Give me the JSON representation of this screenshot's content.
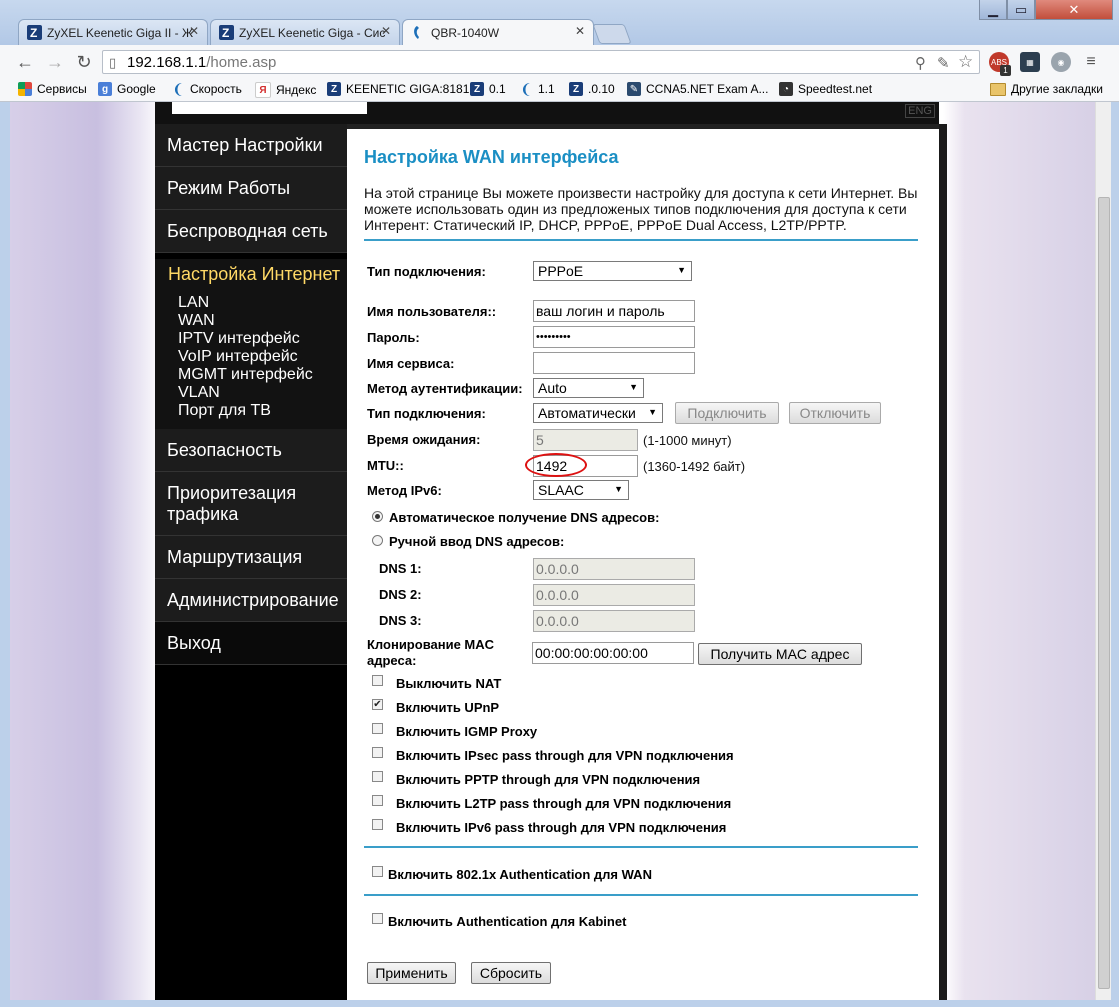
{
  "browser": {
    "tabs": [
      {
        "title": "ZyXEL Keenetic Giga II - Ж"
      },
      {
        "title": "ZyXEL Keenetic Giga - Сис"
      },
      {
        "title": "QBR-1040W"
      }
    ],
    "url_host": "192.168.1.1",
    "url_path": "/home.asp",
    "bookmarks": [
      {
        "label": "Сервисы",
        "color": "#e0483e"
      },
      {
        "label": "Google",
        "color": "#4a7fd8"
      },
      {
        "label": "Скорость",
        "color": "#1d6fb8"
      },
      {
        "label": "Яндекс",
        "color": "#d32f2f"
      },
      {
        "label": "KEENETIC GIGA:8181",
        "color": "#1a3d78"
      },
      {
        "label": "0.1",
        "color": "#1a3d78"
      },
      {
        "label": "1.1",
        "color": "#1d6fb8"
      },
      {
        "label": ".0.10",
        "color": "#1a3d78"
      },
      {
        "label": "CCNA5.NET Exam A...",
        "color": "#2b4a6e"
      },
      {
        "label": "Speedtest.net",
        "color": "#333333"
      }
    ],
    "other_bookmarks": "Другие закладки",
    "lang_button": "ENG",
    "ext_badge": "1"
  },
  "sidebar": {
    "items_top": [
      "Мастер Настройки",
      "Режим Работы",
      "Беспроводная сеть"
    ],
    "active": "Настройка Интернет",
    "sub_items": [
      "LAN",
      "WAN",
      "IPTV интерфейс",
      "VoIP интерфейс",
      "MGMT интерфейс",
      "VLAN",
      "Порт для ТВ"
    ],
    "items_bottom": [
      "Безопасность",
      "Приоритезация трафика",
      "Маршрутизация",
      "Администрирование",
      "Выход"
    ]
  },
  "page": {
    "title": "Настройка WAN интерфейса",
    "description": "На этой странице Вы можете произвести настройку для доступа к сети Интернет. Вы можете использовать один из предложеных типов подключения для доступа к сети Интерент: Статический IP, DHCP, PPPoE, PPPoE Dual Access, L2TP/PPTP.",
    "conn_type_label": "Тип подключения:",
    "conn_type_value": "PPPoE",
    "username_label": "Имя пользователя::",
    "username_value": "ваш логин и пароль",
    "password_label": "Пароль:",
    "password_value": "•••••••••",
    "service_label": "Имя сервиса:",
    "service_value": "",
    "auth_label": "Метод аутентификации:",
    "auth_value": "Auto",
    "conn_mode_label": "Тип подключения:",
    "conn_mode_value": "Автоматически",
    "connect_btn": "Подключить",
    "disconnect_btn": "Отключить",
    "idle_label": "Время ожидания:",
    "idle_value": "5",
    "idle_hint": "(1-1000 минут)",
    "mtu_label": "MTU::",
    "mtu_value": "1492",
    "mtu_hint": "(1360-1492 байт)",
    "ipv6_label": "Метод IPv6:",
    "ipv6_value": "SLAAC",
    "dns_auto": "Автоматическое получение DNS адресов:",
    "dns_manual": "Ручной ввод DNS адресов:",
    "dns1_label": "DNS 1:",
    "dns1_value": "0.0.0.0",
    "dns2_label": "DNS 2:",
    "dns2_value": "0.0.0.0",
    "dns3_label": "DNS 3:",
    "dns3_value": "0.0.0.0",
    "mac_label_1": "Клонирование MAC",
    "mac_label_2": "адреса:",
    "mac_value": "00:00:00:00:00:00",
    "mac_btn": "Получить MAC адрес",
    "options": [
      {
        "label": "Выключить NAT",
        "checked": false
      },
      {
        "label": "Включить UPnP",
        "checked": true
      },
      {
        "label": "Включить IGMP Proxy",
        "checked": false
      },
      {
        "label": "Включить IPsec pass through для VPN подключения",
        "checked": false
      },
      {
        "label": "Включить PPTP through для VPN подключения",
        "checked": false
      },
      {
        "label": "Включить L2TP pass through для VPN подключения",
        "checked": false
      },
      {
        "label": "Включить IPv6 pass through для VPN подключения",
        "checked": false
      }
    ],
    "dot1x_label": "Включить 802.1x Authentication для WAN",
    "kabinet_label": "Включить Authentication для Kabinet",
    "apply_btn": "Применить",
    "reset_btn": "Сбросить"
  }
}
